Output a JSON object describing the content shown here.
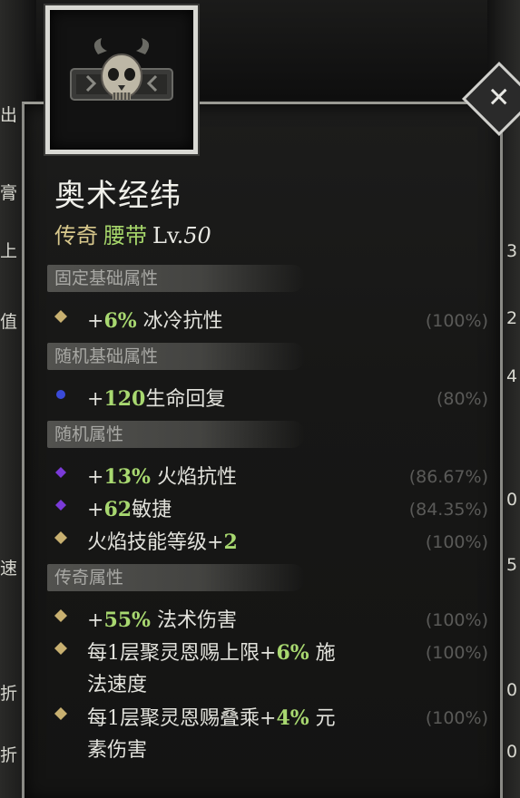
{
  "item": {
    "name": "奥术经纬",
    "rarity": "传奇",
    "type": "腰带",
    "level_prefix": "Lv.",
    "level_value": "50",
    "icon": "belt-skull-icon"
  },
  "close_icon": "close-icon",
  "sections": {
    "fixed_base": "固定基础属性",
    "random_base": "随机基础属性",
    "random": "随机属性",
    "legendary": "传奇属性"
  },
  "stats": {
    "cold_res": {
      "prefix": "+",
      "num": "6%",
      "text": " 冰冷抗性",
      "pct": "(100%)"
    },
    "life_regen": {
      "prefix": "+",
      "num": "120",
      "text": "生命回复",
      "pct": "(80%)"
    },
    "fire_res": {
      "prefix": "+",
      "num": "13%",
      "text": " 火焰抗性",
      "pct": "(86.67%)"
    },
    "agility": {
      "prefix": "+",
      "num": "62",
      "text": "敏捷",
      "pct": "(84.35%)"
    },
    "fire_skill": {
      "text": "火焰技能等级+",
      "num": "2",
      "pct": "(100%)"
    },
    "spell_dmg": {
      "prefix": "+",
      "num": "55%",
      "text": " 法术伤害",
      "pct": "(100%)"
    },
    "focus_cast": {
      "text": "每1层聚灵恩赐上限+",
      "num": "6%",
      "text2": " 施",
      "line2": "法速度",
      "pct": "(100%)"
    },
    "focus_elem": {
      "text": "每1层聚灵恩赐叠乘+",
      "num": "4%",
      "text2": " 元",
      "line2": "素伤害",
      "pct": "(100%)"
    }
  },
  "edge_chars": {
    "l1": "出",
    "l2": "膏",
    "l3": "上",
    "l4": "值",
    "l5": "速",
    "l6": "折",
    "l7": "折",
    "r1": "3",
    "r2": "2",
    "r3": "4",
    "r4": "0",
    "r5": "5",
    "r6": "0",
    "r7": "0"
  },
  "colors": {
    "legendary": "#d8c88c",
    "type": "#a6d66a",
    "value_highlight": "#a8d870",
    "bullet_gold": "#c8b070",
    "bullet_blue": "#3a4ad8",
    "bullet_purple": "#7a3ad8"
  }
}
